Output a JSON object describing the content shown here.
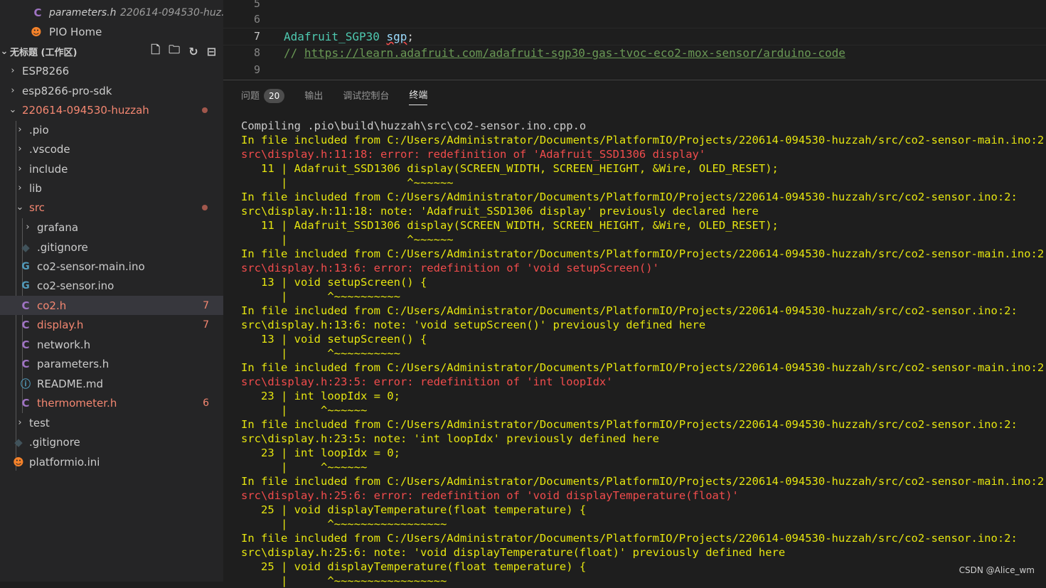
{
  "sidebar": {
    "open_editors": [
      {
        "name": "parameters.h",
        "desc": "220614-094530-huz..."
      },
      {
        "name": "PIO Home"
      }
    ],
    "workspace_title": "无标题 (工作区)",
    "tree": [
      {
        "label": "ESP8266",
        "type": "folder"
      },
      {
        "label": "esp8266-pro-sdk",
        "type": "folder"
      },
      {
        "label": "220614-094530-huzzah",
        "type": "folder-open"
      },
      {
        "label": ".pio",
        "type": "folder"
      },
      {
        "label": ".vscode",
        "type": "folder"
      },
      {
        "label": "include",
        "type": "folder"
      },
      {
        "label": "lib",
        "type": "folder"
      },
      {
        "label": "src",
        "type": "folder-open"
      },
      {
        "label": "grafana",
        "type": "folder"
      },
      {
        "label": ".gitignore",
        "type": "git"
      },
      {
        "label": "co2-sensor-main.ino",
        "type": "ino"
      },
      {
        "label": "co2-sensor.ino",
        "type": "ino"
      },
      {
        "label": "co2.h",
        "type": "c",
        "badge": "7"
      },
      {
        "label": "display.h",
        "type": "c",
        "badge": "7"
      },
      {
        "label": "network.h",
        "type": "c"
      },
      {
        "label": "parameters.h",
        "type": "c"
      },
      {
        "label": "README.md",
        "type": "info"
      },
      {
        "label": "thermometer.h",
        "type": "c",
        "badge": "6"
      },
      {
        "label": "test",
        "type": "folder"
      },
      {
        "label": ".gitignore",
        "type": "git"
      },
      {
        "label": "platformio.ini",
        "type": "pio"
      }
    ]
  },
  "editor": {
    "lines": [
      {
        "num": "5",
        "text": ""
      },
      {
        "num": "6",
        "text": ""
      },
      {
        "num": "7",
        "type": "Adafruit_SGP30",
        "var": "sgp",
        "rest": ";"
      },
      {
        "num": "8",
        "comment": "// ",
        "link": "https://learn.adafruit.com/adafruit-sgp30-gas-tvoc-eco2-mox-sensor/arduino-code"
      },
      {
        "num": "9",
        "text": ""
      }
    ]
  },
  "panel": {
    "tabs": [
      {
        "label": "问题",
        "count": "20"
      },
      {
        "label": "输出"
      },
      {
        "label": "调试控制台"
      },
      {
        "label": "终端"
      }
    ],
    "terminal": [
      {
        "c": "w",
        "t": "Compiling .pio\\build\\huzzah\\src\\co2-sensor.ino.cpp.o"
      },
      {
        "c": "y",
        "t": "In file included from C:/Users/Administrator/Documents/PlatformIO/Projects/220614-094530-huzzah/src/co2-sensor-main.ino:2:"
      },
      {
        "c": "r",
        "t": "src\\display.h:11:18: error: redefinition of 'Adafruit_SSD1306 display'"
      },
      {
        "c": "y",
        "t": "   11 | Adafruit_SSD1306 display(SCREEN_WIDTH, SCREEN_HEIGHT, &Wire, OLED_RESET);"
      },
      {
        "c": "y",
        "t": "      |                  ^~~~~~~"
      },
      {
        "c": "y",
        "t": "In file included from C:/Users/Administrator/Documents/PlatformIO/Projects/220614-094530-huzzah/src/co2-sensor.ino:2:"
      },
      {
        "c": "y",
        "t": "src\\display.h:11:18: note: 'Adafruit_SSD1306 display' previously declared here"
      },
      {
        "c": "y",
        "t": "   11 | Adafruit_SSD1306 display(SCREEN_WIDTH, SCREEN_HEIGHT, &Wire, OLED_RESET);"
      },
      {
        "c": "y",
        "t": "      |                  ^~~~~~~"
      },
      {
        "c": "y",
        "t": "In file included from C:/Users/Administrator/Documents/PlatformIO/Projects/220614-094530-huzzah/src/co2-sensor-main.ino:2:"
      },
      {
        "c": "r",
        "t": "src\\display.h:13:6: error: redefinition of 'void setupScreen()'"
      },
      {
        "c": "y",
        "t": "   13 | void setupScreen() {"
      },
      {
        "c": "y",
        "t": "      |      ^~~~~~~~~~~"
      },
      {
        "c": "y",
        "t": "In file included from C:/Users/Administrator/Documents/PlatformIO/Projects/220614-094530-huzzah/src/co2-sensor.ino:2:"
      },
      {
        "c": "y",
        "t": "src\\display.h:13:6: note: 'void setupScreen()' previously defined here"
      },
      {
        "c": "y",
        "t": "   13 | void setupScreen() {"
      },
      {
        "c": "y",
        "t": "      |      ^~~~~~~~~~~"
      },
      {
        "c": "y",
        "t": "In file included from C:/Users/Administrator/Documents/PlatformIO/Projects/220614-094530-huzzah/src/co2-sensor-main.ino:2:"
      },
      {
        "c": "r",
        "t": "src\\display.h:23:5: error: redefinition of 'int loopIdx'"
      },
      {
        "c": "y",
        "t": "   23 | int loopIdx = 0;"
      },
      {
        "c": "y",
        "t": "      |     ^~~~~~~"
      },
      {
        "c": "y",
        "t": "In file included from C:/Users/Administrator/Documents/PlatformIO/Projects/220614-094530-huzzah/src/co2-sensor.ino:2:"
      },
      {
        "c": "y",
        "t": "src\\display.h:23:5: note: 'int loopIdx' previously defined here"
      },
      {
        "c": "y",
        "t": "   23 | int loopIdx = 0;"
      },
      {
        "c": "y",
        "t": "      |     ^~~~~~~"
      },
      {
        "c": "y",
        "t": "In file included from C:/Users/Administrator/Documents/PlatformIO/Projects/220614-094530-huzzah/src/co2-sensor-main.ino:2:"
      },
      {
        "c": "r",
        "t": "src\\display.h:25:6: error: redefinition of 'void displayTemperature(float)'"
      },
      {
        "c": "y",
        "t": "   25 | void displayTemperature(float temperature) {"
      },
      {
        "c": "y",
        "t": "      |      ^~~~~~~~~~~~~~~~~~"
      },
      {
        "c": "y",
        "t": "In file included from C:/Users/Administrator/Documents/PlatformIO/Projects/220614-094530-huzzah/src/co2-sensor.ino:2:"
      },
      {
        "c": "y",
        "t": "src\\display.h:25:6: note: 'void displayTemperature(float)' previously defined here"
      },
      {
        "c": "y",
        "t": "   25 | void displayTemperature(float temperature) {"
      },
      {
        "c": "y",
        "t": "      |      ^~~~~~~~~~~~~~~~~~"
      }
    ]
  },
  "watermark": "CSDN @Alice_wm"
}
